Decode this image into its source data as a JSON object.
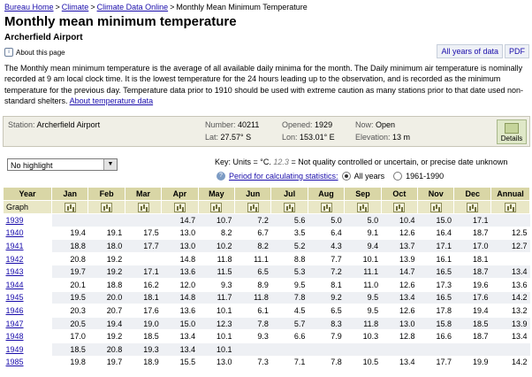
{
  "breadcrumb": {
    "home": "Bureau Home",
    "climate": "Climate",
    "cdo": "Climate Data Online",
    "current": "Monthly Mean Minimum Temperature"
  },
  "title": "Monthly mean minimum temperature",
  "station_name": "Archerfield Airport",
  "about_link": "About this page",
  "tabs": {
    "all_years": "All years of data",
    "pdf": "PDF"
  },
  "description": "The Monthly mean minimum temperature is the average of all available daily minima for the month. The Daily minimum air temperature is nominally recorded at 9 am local clock time. It is the lowest temperature for the 24 hours leading up to the observation, and is recorded as the minimum temperature for the previous day. Temperature data prior to 1910 should be used with extreme caution as many stations prior to that date used non-standard shelters.",
  "description_link": "About temperature data",
  "station": {
    "station_label": "Station:",
    "station_value": "Archerfield Airport",
    "number_label": "Number:",
    "number_value": "40211",
    "opened_label": "Opened:",
    "opened_value": "1929",
    "now_label": "Now:",
    "now_value": "Open",
    "lat_label": "Lat:",
    "lat_value": "27.57° S",
    "lon_label": "Lon:",
    "lon_value": "153.01° E",
    "elev_label": "Elevation:",
    "elev_value": "13 m",
    "details": "Details"
  },
  "controls": {
    "highlight": "No highlight",
    "key_prefix": "Key: Units = °C.",
    "key_sample": "12.3",
    "key_suffix": "= Not quality controlled or uncertain, or precise date unknown",
    "period_link": "Period for calculating statistics:",
    "opt_all": "All years",
    "opt_1961": "1961-1990"
  },
  "table": {
    "headers": [
      "Year",
      "Jan",
      "Feb",
      "Mar",
      "Apr",
      "May",
      "Jun",
      "Jul",
      "Aug",
      "Sep",
      "Oct",
      "Nov",
      "Dec",
      "Annual"
    ],
    "graph_label": "Graph",
    "rows": [
      [
        "1939",
        "",
        "",
        "",
        "14.7",
        "10.7",
        "7.2",
        "5.6",
        "5.0",
        "5.0",
        "10.4",
        "15.0",
        "17.1",
        ""
      ],
      [
        "1940",
        "19.4",
        "19.1",
        "17.5",
        "13.0",
        "8.2",
        "6.7",
        "3.5",
        "6.4",
        "9.1",
        "12.6",
        "16.4",
        "18.7",
        "12.5"
      ],
      [
        "1941",
        "18.8",
        "18.0",
        "17.7",
        "13.0",
        "10.2",
        "8.2",
        "5.2",
        "4.3",
        "9.4",
        "13.7",
        "17.1",
        "17.0",
        "12.7"
      ],
      [
        "1942",
        "20.8",
        "19.2",
        "",
        "14.8",
        "11.8",
        "11.1",
        "8.8",
        "7.7",
        "10.1",
        "13.9",
        "16.1",
        "18.1",
        ""
      ],
      [
        "1943",
        "19.7",
        "19.2",
        "17.1",
        "13.6",
        "11.5",
        "6.5",
        "5.3",
        "7.2",
        "11.1",
        "14.7",
        "16.5",
        "18.7",
        "13.4"
      ],
      [
        "1944",
        "20.1",
        "18.8",
        "16.2",
        "12.0",
        "9.3",
        "8.9",
        "9.5",
        "8.1",
        "11.0",
        "12.6",
        "17.3",
        "19.6",
        "13.6"
      ],
      [
        "1945",
        "19.5",
        "20.0",
        "18.1",
        "14.8",
        "11.7",
        "11.8",
        "7.8",
        "9.2",
        "9.5",
        "13.4",
        "16.5",
        "17.6",
        "14.2"
      ],
      [
        "1946",
        "20.3",
        "20.7",
        "17.6",
        "13.6",
        "10.1",
        "6.1",
        "4.5",
        "6.5",
        "9.5",
        "12.6",
        "17.8",
        "19.4",
        "13.2"
      ],
      [
        "1947",
        "20.5",
        "19.4",
        "19.0",
        "15.0",
        "12.3",
        "7.8",
        "5.7",
        "8.3",
        "11.8",
        "13.0",
        "15.8",
        "18.5",
        "13.9"
      ],
      [
        "1948",
        "17.0",
        "19.2",
        "18.5",
        "13.4",
        "10.1",
        "9.3",
        "6.6",
        "7.9",
        "10.3",
        "12.8",
        "16.6",
        "18.7",
        "13.4"
      ],
      [
        "1949",
        "18.5",
        "20.8",
        "19.3",
        "13.4",
        "10.1",
        "",
        "",
        "",
        "",
        "",
        "",
        "",
        ""
      ],
      [
        "1985",
        "19.8",
        "19.7",
        "18.9",
        "15.5",
        "13.0",
        "7.3",
        "7.1",
        "7.8",
        "10.5",
        "13.4",
        "17.7",
        "19.9",
        "14.2"
      ]
    ]
  }
}
